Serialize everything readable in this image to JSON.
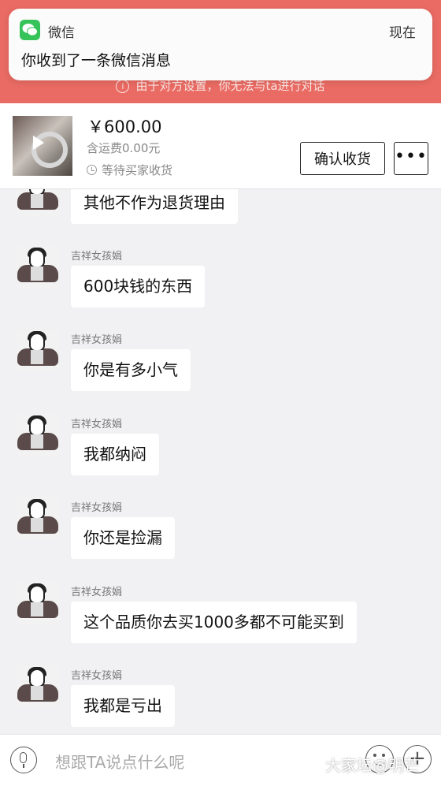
{
  "banner": {
    "text": "由于对方设置，你无法与ta进行对话",
    "info_icon": "info-icon",
    "color": "#e96b63"
  },
  "notification": {
    "app_name": "微信",
    "time": "现在",
    "message": "你收到了一条微信消息",
    "icon": "wechat-icon"
  },
  "product": {
    "price": "￥600.00",
    "shipping": "含运费0.00元",
    "status": "等待买家收货",
    "confirm_label": "确认收货",
    "more_label": "•••"
  },
  "chat": {
    "messages": [
      {
        "sender": "",
        "text": "其他不作为退货理由"
      },
      {
        "sender": "吉祥女孩娟",
        "text": "600块钱的东西"
      },
      {
        "sender": "吉祥女孩娟",
        "text": "你是有多小气"
      },
      {
        "sender": "吉祥女孩娟",
        "text": "我都纳闷"
      },
      {
        "sender": "吉祥女孩娟",
        "text": "你还是捡漏"
      },
      {
        "sender": "吉祥女孩娟",
        "text": "这个品质你去买1000多都不可能买到"
      },
      {
        "sender": "吉祥女孩娟",
        "text": "我都是亏出"
      }
    ]
  },
  "input": {
    "placeholder": "想跟TA说点什么呢"
  },
  "watermark": "大家坛@明芒"
}
